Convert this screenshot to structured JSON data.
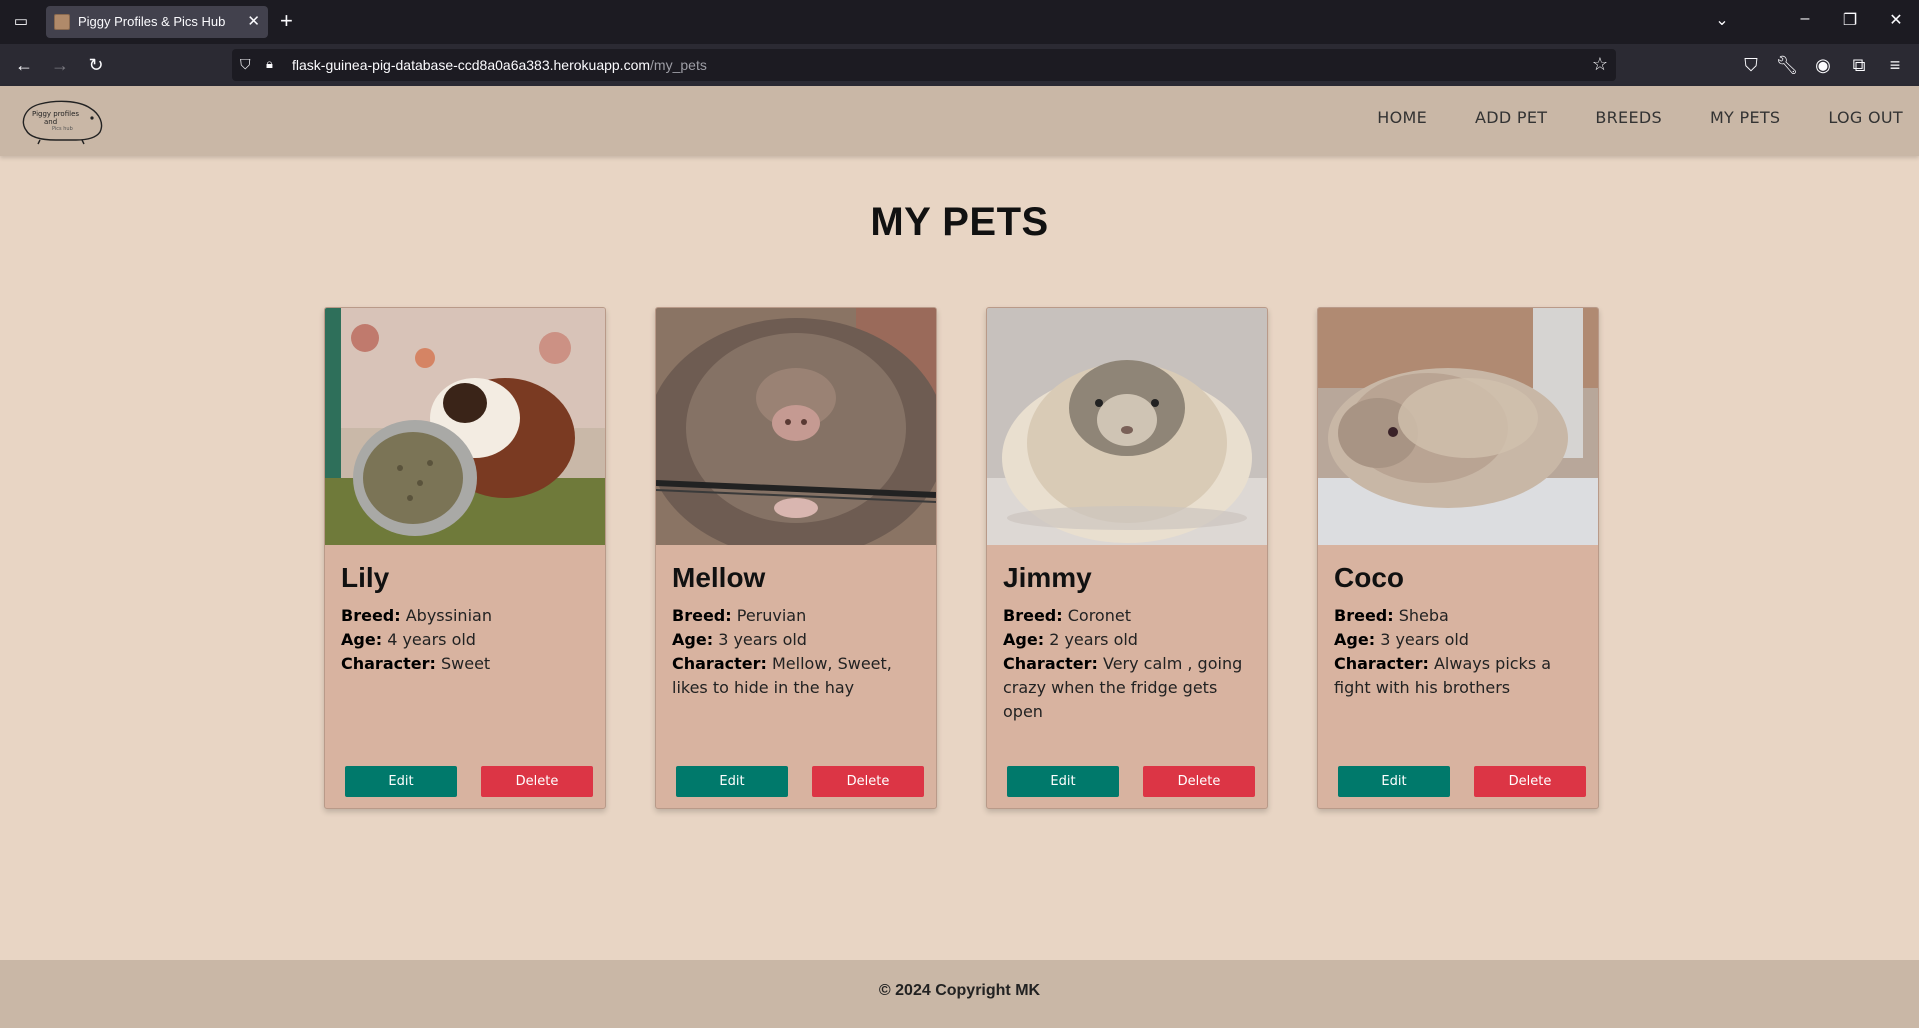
{
  "browser": {
    "tab_title": "Piggy Profiles & Pics Hub",
    "url_host": "flask-guinea-pig-database-ccd8a0a6a383.herokuapp.com",
    "url_path": "/my_pets"
  },
  "header": {
    "logo_text_1": "Piggy profiles",
    "logo_text_2": "and",
    "logo_text_3": "Pics hub",
    "nav": {
      "home": "HOME",
      "add_pet": "ADD PET",
      "breeds": "BREEDS",
      "my_pets": "MY PETS",
      "log_out": "LOG OUT"
    }
  },
  "main": {
    "title": "MY PETS",
    "labels": {
      "breed": "Breed:",
      "age": "Age:",
      "character": "Character:",
      "edit": "Edit",
      "delete": "Delete"
    },
    "pets": [
      {
        "name": "Lily",
        "breed": "Abyssinian",
        "age": "4 years old",
        "character": "Sweet"
      },
      {
        "name": "Mellow",
        "breed": "Peruvian",
        "age": "3 years old",
        "character": "Mellow, Sweet, likes to hide in the hay"
      },
      {
        "name": "Jimmy",
        "breed": "Coronet",
        "age": "2 years old",
        "character": "Very calm , going crazy when the fridge gets open"
      },
      {
        "name": "Coco",
        "breed": "Sheba",
        "age": "3 years old",
        "character": "Always picks a fight with his brothers"
      }
    ]
  },
  "footer": {
    "text": "© 2024 Copyright MK"
  }
}
